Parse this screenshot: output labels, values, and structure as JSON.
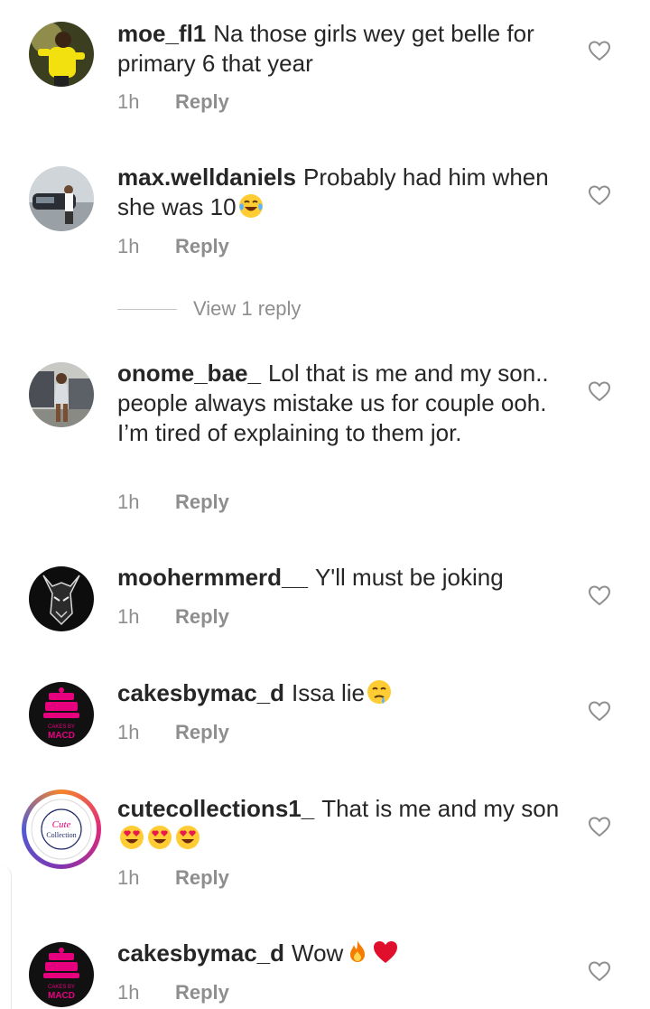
{
  "comments": [
    {
      "username": "moe_fl1",
      "text": "Na those girls wey get belle for primary 6 that year",
      "time": "1h",
      "reply": "Reply"
    },
    {
      "username": "max.welldaniels",
      "text": "Probably had him when she was 10",
      "time": "1h",
      "reply": "Reply",
      "emoji": [
        "tears-of-joy"
      ]
    },
    {
      "username": "onome_bae_",
      "text": "Lol that is me and my son.. people always mistake us for couple ooh. I’m tired of explaining to them jor.",
      "time": "1h",
      "reply": "Reply"
    },
    {
      "username": "moohermmerd__",
      "text": "Y'll must be joking",
      "time": "1h",
      "reply": "Reply"
    },
    {
      "username": "cakesbymac_d",
      "text": "Issa lie",
      "time": "1h",
      "reply": "Reply",
      "emoji": [
        "drooling-face"
      ]
    },
    {
      "username": "cutecollections1_",
      "text": "That is me and my son",
      "time": "1h",
      "reply": "Reply",
      "emoji": [
        "heart-eyes",
        "heart-eyes",
        "heart-eyes"
      ]
    },
    {
      "username": "cakesbymac_d",
      "text": "Wow",
      "time": "1h",
      "reply": "Reply",
      "emoji": [
        "fire",
        "red-heart"
      ]
    }
  ],
  "view_replies_label": "View 1 reply",
  "avatar_text": {
    "cakes_line1": "CAKES BY",
    "cakes_line2": "MACD",
    "cute_line1": "Cute",
    "cute_line2": "Collection"
  },
  "colors": {
    "text": "#262626",
    "muted": "#8e8e8e",
    "cakes_pink": "#e6007e"
  }
}
